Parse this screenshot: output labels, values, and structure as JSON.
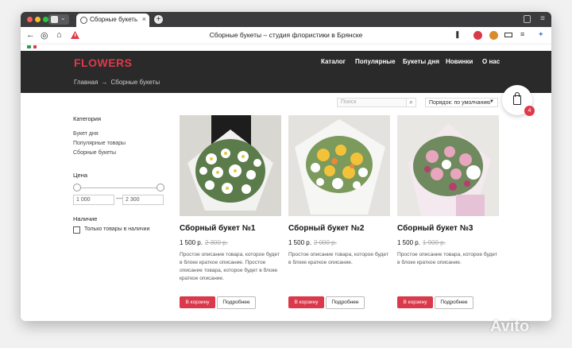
{
  "browser": {
    "tab_title": "Сборные букеты – студ",
    "page_title": "Сборные букеты – студия флористики в Брянске",
    "new_tab": "+",
    "close": "×"
  },
  "site": {
    "logo": "FLOWERS",
    "nav": [
      "Каталог",
      "Популярные",
      "Букеты дня",
      "Новинки",
      "О нас"
    ],
    "breadcrumb": {
      "home": "Главная",
      "separator": "→",
      "current": "Сборные букеты"
    },
    "cart_count": "4",
    "accent": "#e0394a"
  },
  "toolbar": {
    "search_placeholder": "Поиск",
    "sort_label": "Порядок: по умолчанию"
  },
  "sidebar": {
    "category_title": "Категория",
    "categories": [
      "Букет дня",
      "Популярные товары",
      "Сборные букеты"
    ],
    "price_title": "Цена",
    "price_min": "1 000",
    "price_dash": "—",
    "price_max": "2 300",
    "stock_title": "Наличие",
    "stock_label": "Только товары в наличии"
  },
  "products": [
    {
      "name": "Сборный букет №1",
      "price": "1 500 р.",
      "old_price": "2 300 р.",
      "description": "Простое описание товара, которое будет в блоке краткое описание. Простое описание товара, которое будет в блоке краткое описание.",
      "cart_label": "В корзину",
      "more_label": "Подробнее"
    },
    {
      "name": "Сборный букет №2",
      "price": "1 500 р.",
      "old_price": "2 000 р.",
      "description": "Простое описание товара, которое будет в блоке краткое описание.",
      "cart_label": "В корзину",
      "more_label": "Подробнее"
    },
    {
      "name": "Сборный букет №3",
      "price": "1 500 р.",
      "old_price": "1 900 р.",
      "description": "Простое описание товара, которое будет в блоке краткое описание.",
      "cart_label": "В корзину",
      "more_label": "Подробнее"
    }
  ],
  "watermark": "Avito"
}
